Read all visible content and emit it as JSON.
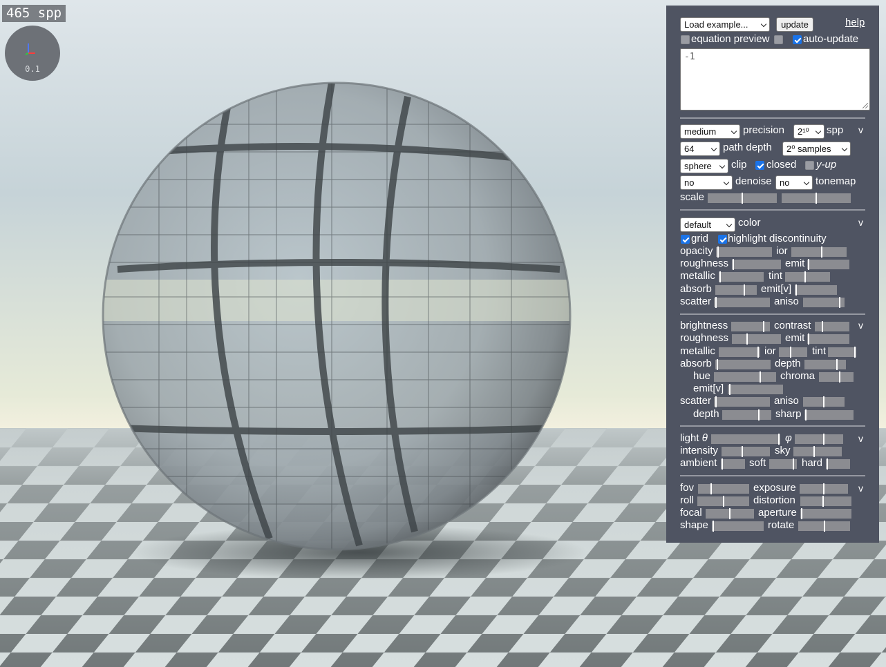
{
  "overlay": {
    "spp_counter": "465 spp",
    "gizmo_scale": "0.1"
  },
  "colors": {
    "panel_bg": "#4f5462",
    "checkbox_on": "#1a73e8",
    "slider_track": "#8b8c91",
    "sky_top": "#c6d3d8",
    "horizon": "#f1efdf",
    "checker_light": "#d7dfdf",
    "checker_dark": "#6f7678"
  },
  "toolbar": {
    "load_example": "Load example...",
    "update": "update",
    "help": "help",
    "equation_preview": "equation preview",
    "auto_update": "auto-update"
  },
  "equation": {
    "value": "-1"
  },
  "render": {
    "precision_value": "medium",
    "precision_label": "precision",
    "spp_value": "2¹⁰",
    "spp_label": "spp",
    "path_depth_value": "64",
    "path_depth_label": "path depth",
    "samples_value": "2⁰ samples",
    "clip_value": "sphere",
    "clip_label": "clip",
    "closed_label": "closed",
    "yup_label": "y-up",
    "denoise_value": "no",
    "denoise_label": "denoise",
    "tonemap_value": "no",
    "tonemap_label": "tonemap",
    "scale_label": "scale",
    "collapse": "v"
  },
  "material": {
    "color_value": "default",
    "color_label": "color",
    "grid_label": "grid",
    "highlight_label": "highlight discontinuity",
    "labels": {
      "opacity": "opacity",
      "ior": "ior",
      "roughness": "roughness",
      "emit": "emit",
      "metallic": "metallic",
      "tint": "tint",
      "absorb": "absorb",
      "emitv": "emit[v]",
      "scatter": "scatter",
      "aniso": "aniso"
    },
    "collapse": "v"
  },
  "grid_material": {
    "labels": {
      "brightness": "brightness",
      "contrast": "contrast",
      "roughness": "roughness",
      "emit": "emit",
      "metallic": "metallic",
      "ior": "ior",
      "tint": "tint",
      "absorb": "absorb",
      "depth": "depth",
      "hue": "hue",
      "chroma": "chroma",
      "emitv": "emit[v]",
      "scatter": "scatter",
      "aniso": "aniso",
      "depth2": "depth",
      "sharp": "sharp"
    },
    "collapse": "v"
  },
  "lighting": {
    "labels": {
      "light": "light",
      "theta": "θ",
      "phi": "φ",
      "intensity": "intensity",
      "sky": "sky",
      "ambient": "ambient",
      "soft": "soft",
      "hard": "hard"
    },
    "collapse": "v"
  },
  "camera": {
    "labels": {
      "fov": "fov",
      "exposure": "exposure",
      "roll": "roll",
      "distortion": "distortion",
      "focal": "focal",
      "aperture": "aperture",
      "shape": "shape",
      "rotate": "rotate"
    },
    "collapse": "v"
  },
  "slider_levels": {
    "scale_a": 0.5,
    "scale_b": 0.5,
    "opacity": 0.02,
    "ior": 0.55,
    "roughness": 0.02,
    "emit": 0.02,
    "metallic": 0.02,
    "tint": 0.45,
    "absorb": 0.7,
    "emitv": 0.02,
    "scatter": 0.02,
    "aniso": 0.9,
    "brightness": 0.85,
    "contrast": 0.2,
    "g_roughness": 0.3,
    "g_emit": 0.02,
    "g_metallic": 0.97,
    "g_ior": 0.42,
    "g_tint": 0.97,
    "g_absorb": 0.02,
    "g_depth": 0.8,
    "hue": 0.75,
    "chroma": 0.6,
    "g_emitv": 0.03,
    "g_scatter": 0.02,
    "g_aniso": 0.5,
    "depth2": 0.75,
    "sharp": 0.02,
    "theta": 0.99,
    "phi": 0.6,
    "intensity": 0.42,
    "sky": 0.42,
    "ambient": 0.02,
    "soft": 0.9,
    "hard": 0.02,
    "fov": 0.25,
    "exposure": 0.5,
    "roll": 0.5,
    "distortion": 0.45,
    "focal": 0.5,
    "aperture": 0.02,
    "shape": 0.02,
    "rotate": 0.5
  }
}
